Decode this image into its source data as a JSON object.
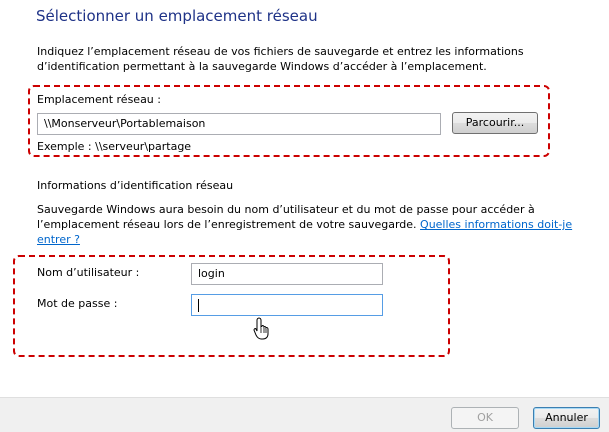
{
  "header": {
    "title": "Sélectionner un emplacement réseau"
  },
  "intro": {
    "line1": "Indiquez l’emplacement réseau de vos fichiers de sauvegarde et entrez les informations",
    "line2": "d’identification permettant à la sauvegarde Windows d’accéder à l’emplacement."
  },
  "network_location": {
    "label": "Emplacement réseau :",
    "value": "\\\\Monserveur\\Portablemaison",
    "browse_label": "Parcourir...",
    "example": "Exemple : \\\\serveur\\partage"
  },
  "credentials": {
    "heading": "Informations d’identification réseau",
    "desc_line1": "Sauvegarde Windows aura besoin du nom d’utilisateur et du mot de passe pour accéder à",
    "desc_line2_prefix": "l’emplacement réseau lors de l’enregistrement de votre sauvegarde. ",
    "link_part1": "Quelles informations doit-je",
    "link_part2": "entrer ?",
    "username_label": "Nom d’utilisateur :",
    "username_value": "login",
    "password_label": "Mot de passe :",
    "password_value": ""
  },
  "footer": {
    "ok_label": "OK",
    "cancel_label": "Annuler"
  },
  "colors": {
    "title": "#1e3287",
    "highlight": "#cc0000",
    "link": "#0066cc"
  }
}
